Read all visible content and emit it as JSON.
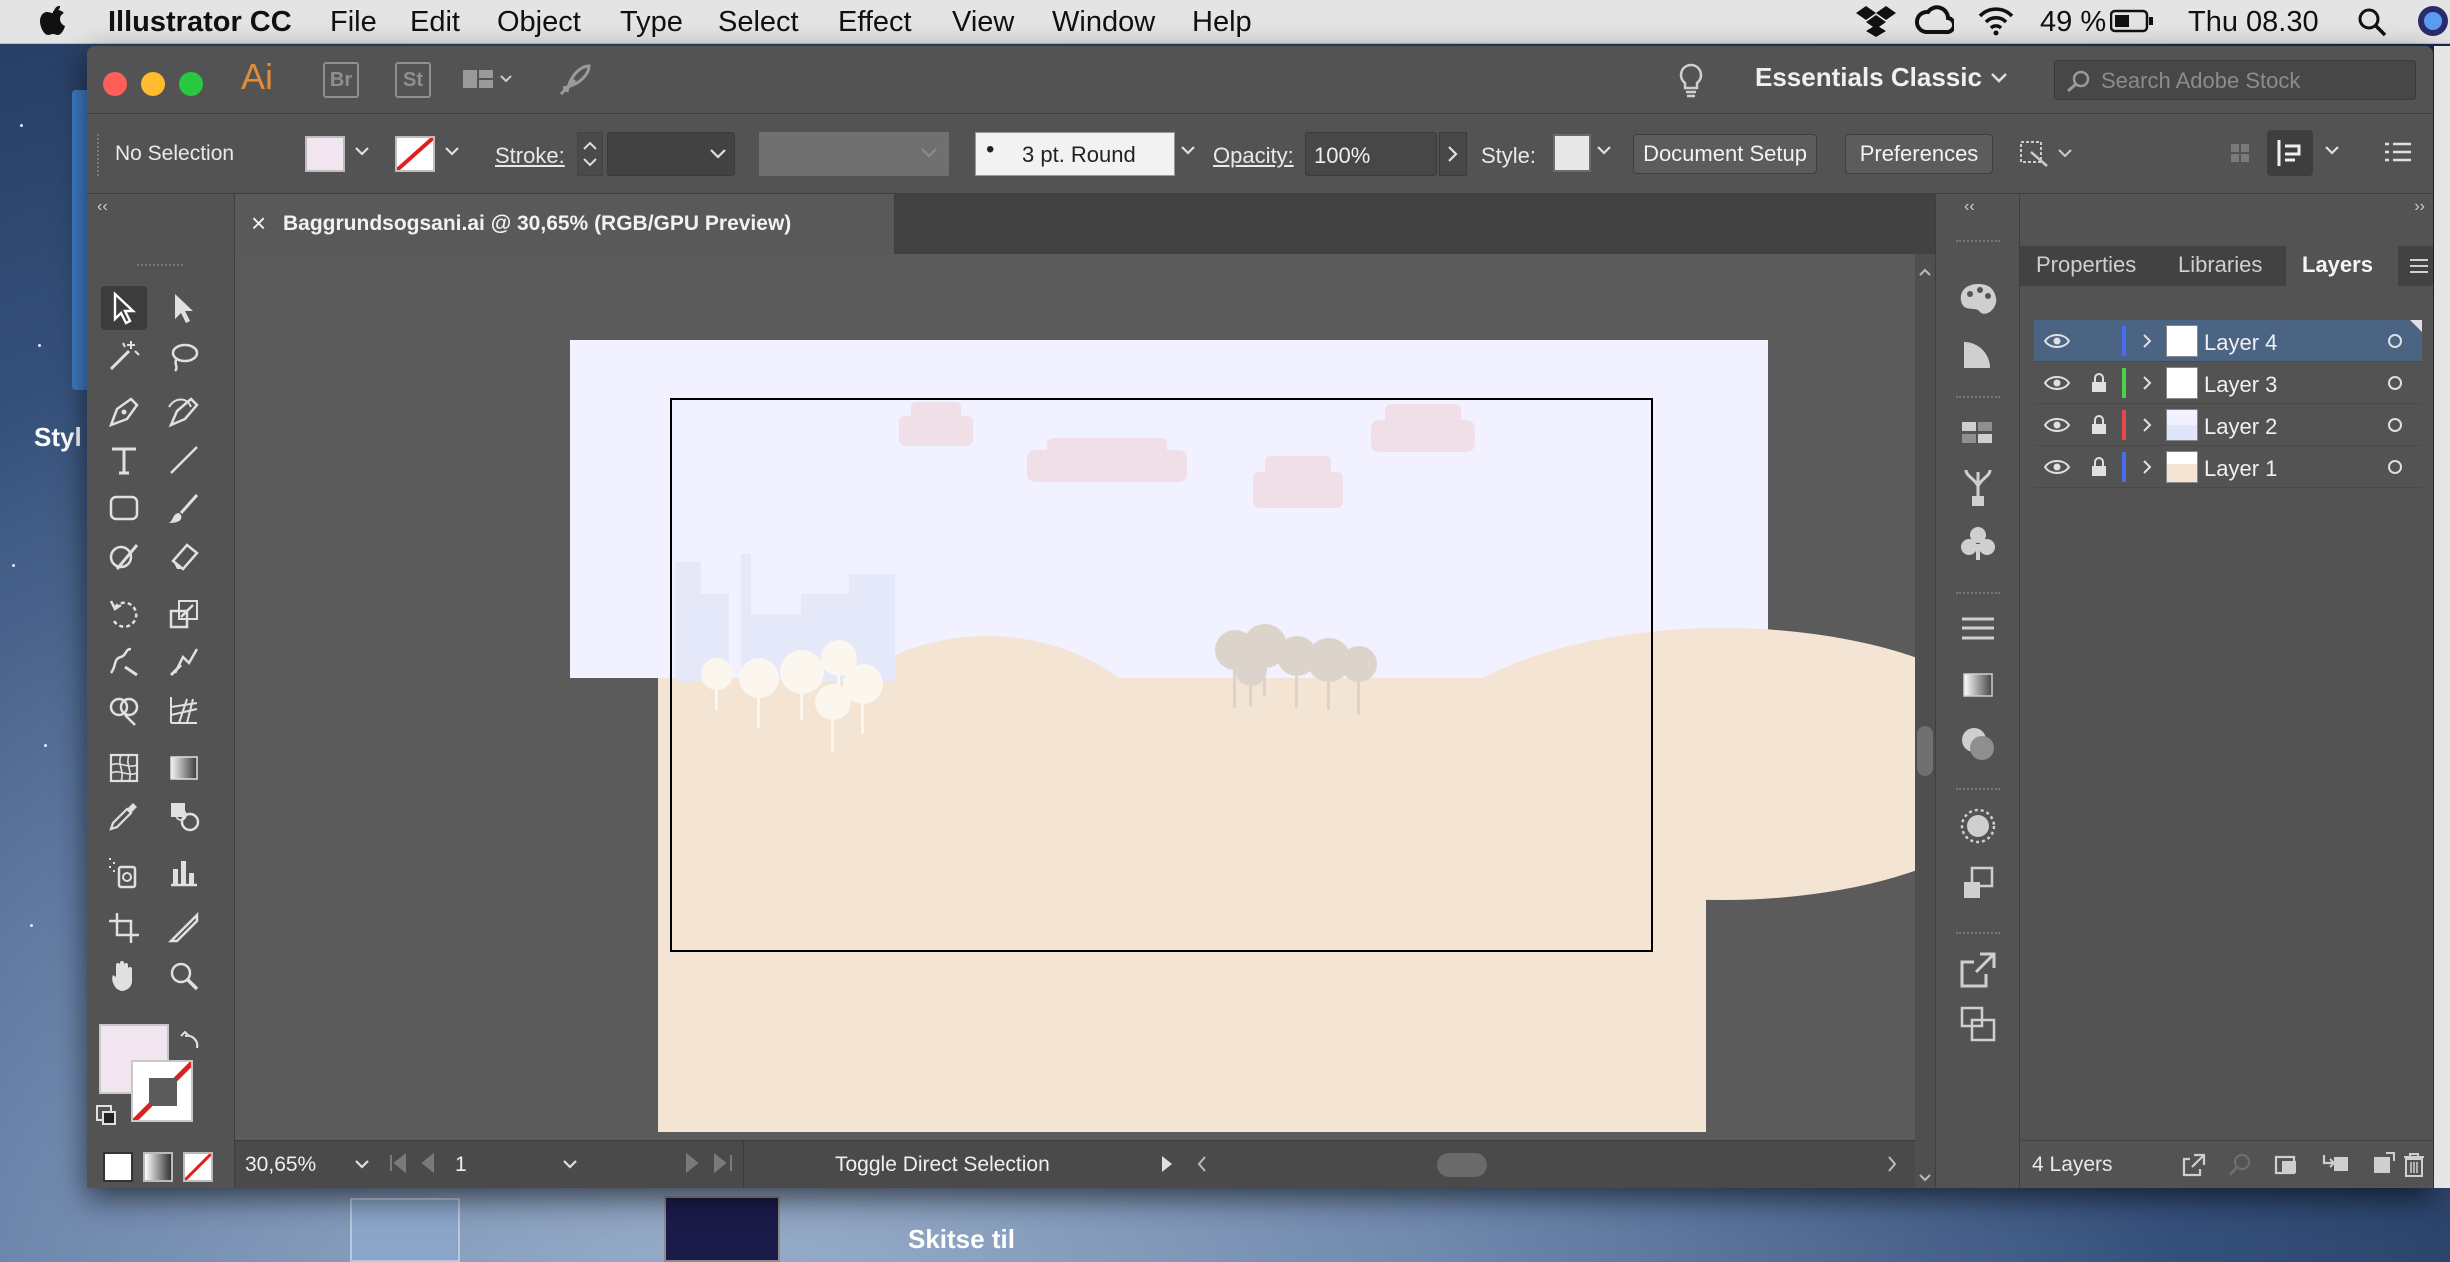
{
  "menubar": {
    "app_name": "Illustrator CC",
    "menus": [
      "File",
      "Edit",
      "Object",
      "Type",
      "Select",
      "Effect",
      "View",
      "Window",
      "Help"
    ],
    "battery": "49 %",
    "clock": "Thu 08.30"
  },
  "desktop": {
    "left_fragment": "Styl",
    "bottom_label": "Skitse til"
  },
  "titlebar": {
    "ai_logo": "Ai",
    "bridge_label": "Br",
    "stock_label": "St",
    "workspace": "Essentials Classic",
    "search_placeholder": "Search Adobe Stock"
  },
  "control_bar": {
    "selection": "No Selection",
    "stroke_label": "Stroke:",
    "brush": "3 pt. Round",
    "opacity_label": "Opacity:",
    "opacity_value": "100%",
    "style_label": "Style:",
    "document_setup": "Document Setup",
    "preferences": "Preferences",
    "fill_color": "#f1e6ef"
  },
  "document": {
    "tab_title": "Baggrundsogsani.ai @ 30,65% (RGB/GPU Preview)",
    "close_glyph": "×",
    "zoom": "30,65%",
    "artboard_number": "1",
    "status_text": "Toggle Direct Selection"
  },
  "layers_panel": {
    "tabs": [
      "Properties",
      "Libraries",
      "Layers"
    ],
    "active_tab": "Layers",
    "layers": [
      {
        "name": "Layer 4",
        "color": "#4a6cf0",
        "locked": false,
        "selected": true
      },
      {
        "name": "Layer 3",
        "color": "#4ad14a",
        "locked": true,
        "selected": false
      },
      {
        "name": "Layer 2",
        "color": "#e84848",
        "locked": true,
        "selected": false
      },
      {
        "name": "Layer 1",
        "color": "#4a6cf0",
        "locked": true,
        "selected": false
      }
    ],
    "count_label": "4 Layers"
  },
  "icons": {
    "tools": [
      "selection-tool-icon",
      "direct-selection-tool-icon",
      "magic-wand-tool-icon",
      "lasso-tool-icon",
      "pen-tool-icon",
      "curvature-tool-icon",
      "type-tool-icon",
      "line-segment-tool-icon",
      "rectangle-tool-icon",
      "paintbrush-tool-icon",
      "shaper-tool-icon",
      "eraser-tool-icon",
      "rotate-tool-icon",
      "scale-tool-icon",
      "warp-tool-icon",
      "free-transform-tool-icon",
      "shape-builder-tool-icon",
      "perspective-grid-tool-icon",
      "mesh-tool-icon",
      "gradient-tool-icon",
      "eyedropper-tool-icon",
      "blend-tool-icon",
      "symbol-sprayer-tool-icon",
      "column-graph-tool-icon",
      "artboard-tool-icon",
      "slice-tool-icon",
      "hand-tool-icon",
      "zoom-tool-icon"
    ]
  }
}
